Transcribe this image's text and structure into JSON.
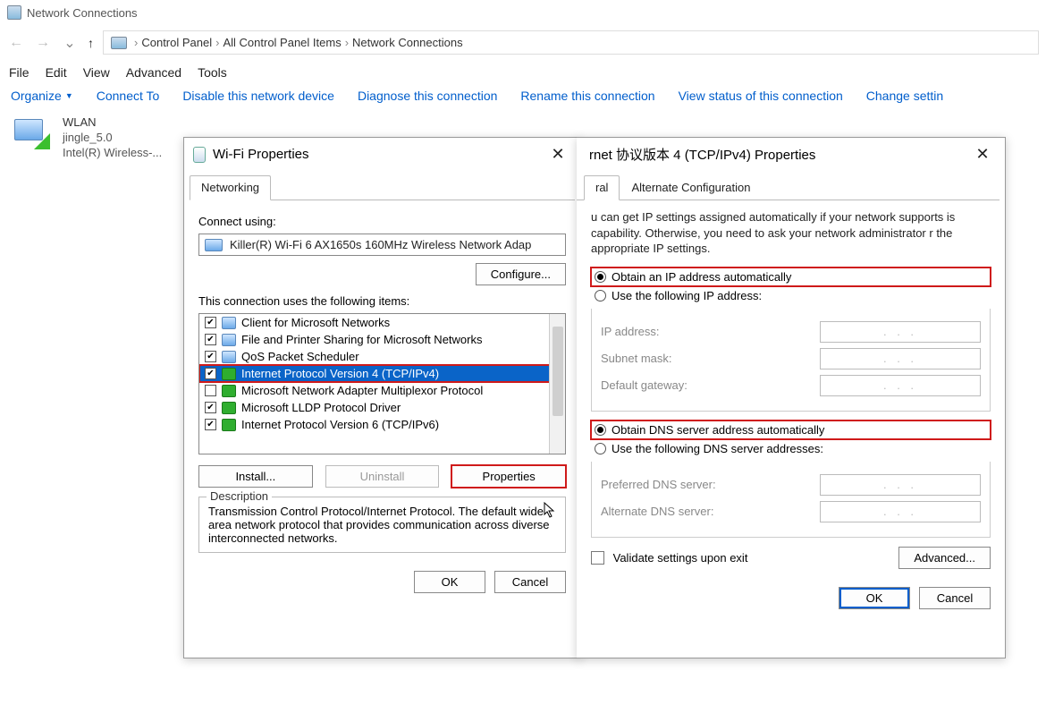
{
  "window": {
    "title": "Network Connections"
  },
  "breadcrumb": {
    "root_icon": "pc-icon",
    "items": [
      "Control Panel",
      "All Control Panel Items",
      "Network Connections"
    ]
  },
  "menu": {
    "file": "File",
    "edit": "Edit",
    "view": "View",
    "advanced": "Advanced",
    "tools": "Tools"
  },
  "toolbar": {
    "organize": "Organize",
    "connect_to": "Connect To",
    "disable": "Disable this network device",
    "diagnose": "Diagnose this connection",
    "rename": "Rename this connection",
    "view_status": "View status of this connection",
    "change": "Change settin"
  },
  "adapter": {
    "name": "WLAN",
    "ssid": "jingle_5.0",
    "device": "Intel(R) Wireless-..."
  },
  "wifi_dialog": {
    "title": "Wi-Fi Properties",
    "tab": "Networking",
    "connect_using": "Connect using:",
    "adapter": "Killer(R) Wi-Fi 6 AX1650s 160MHz Wireless Network Adap",
    "configure": "Configure...",
    "uses_label": "This connection uses the following items:",
    "items": [
      {
        "checked": true,
        "icon": "net",
        "label": "Client for Microsoft Networks"
      },
      {
        "checked": true,
        "icon": "net",
        "label": "File and Printer Sharing for Microsoft Networks"
      },
      {
        "checked": true,
        "icon": "net",
        "label": "QoS Packet Scheduler"
      },
      {
        "checked": true,
        "icon": "green",
        "label": "Internet Protocol Version 4 (TCP/IPv4)",
        "selected": true,
        "red": true
      },
      {
        "checked": false,
        "icon": "green",
        "label": "Microsoft Network Adapter Multiplexor Protocol"
      },
      {
        "checked": true,
        "icon": "green",
        "label": "Microsoft LLDP Protocol Driver"
      },
      {
        "checked": true,
        "icon": "green",
        "label": "Internet Protocol Version 6 (TCP/IPv6)"
      }
    ],
    "install": "Install...",
    "uninstall": "Uninstall",
    "properties": "Properties",
    "desc_legend": "Description",
    "desc_text": "Transmission Control Protocol/Internet Protocol. The default wide area network protocol that provides communication across diverse interconnected networks.",
    "ok": "OK",
    "cancel": "Cancel"
  },
  "ip_dialog": {
    "title": "rnet 协议版本 4 (TCP/IPv4) Properties",
    "tab_general": "ral",
    "tab_alt": "Alternate Configuration",
    "info": "u can get IP settings assigned automatically if your network supports is capability. Otherwise, you need to ask your network administrator r the appropriate IP settings.",
    "r_auto_ip": "Obtain an IP address automatically",
    "r_use_ip": "Use the following IP address:",
    "lbl_ip": "IP address:",
    "lbl_mask": "Subnet mask:",
    "lbl_gw": "Default gateway:",
    "r_auto_dns": "Obtain DNS server address automatically",
    "r_use_dns": "Use the following DNS server addresses:",
    "lbl_pref": "Preferred DNS server:",
    "lbl_alt": "Alternate DNS server:",
    "validate": "Validate settings upon exit",
    "advanced": "Advanced...",
    "ok": "OK",
    "cancel": "Cancel",
    "ip_dots": ".   .   ."
  }
}
